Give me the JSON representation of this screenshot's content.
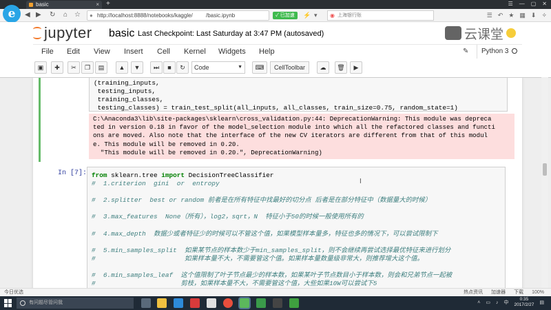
{
  "browser": {
    "tab_title": "basic",
    "tab_close": "×",
    "new_tab": "+",
    "url": "http://localhost:8888/notebooks/kaggle//basic.ipynb",
    "accelerate_label": "✓ 已加速",
    "search_placeholder": "上海银行账",
    "status_left": "今日优选",
    "status_right": [
      "热点资讯",
      "加速器",
      "下载",
      "100%"
    ]
  },
  "jupyter": {
    "logo_text": "jupyter",
    "notebook_name": "basic",
    "checkpoint": "Last Checkpoint: Last Saturday at 3:47 PM (autosaved)",
    "kernel": "Python 3",
    "menu": [
      "File",
      "Edit",
      "View",
      "Insert",
      "Cell",
      "Kernel",
      "Widgets",
      "Help"
    ],
    "cell_type": "Code",
    "celltoolbar_label": "CellToolbar"
  },
  "watermark": {
    "text": "云课堂"
  },
  "cells": {
    "cell1_code": "(training_inputs,\n testing_inputs,\n training_classes,\n testing_classes) = train_test_split(all_inputs, all_classes, train_size=0.75, random_state=1)",
    "cell1_stderr": "C:\\Anaconda3\\lib\\site-packages\\sklearn\\cross_validation.py:44: DeprecationWarning: This module was depreca\nted in version 0.18 in favor of the model_selection module into which all the refactored classes and functi\nons are moved. Also note that the interface of the new CV iterators are different from that of this modul\ne. This module will be removed in 0.20.\n  \"This module will be removed in 0.20.\", DeprecationWarning)",
    "cell2_prompt": "In [7]:",
    "cell2_import_kw1": "from",
    "cell2_import_mod": " sklearn.tree ",
    "cell2_import_kw2": "import",
    "cell2_import_name": " DecisionTreeClassifier",
    "cell2_comments": [
      "#  1.criterion  gini  or  entropy",
      "",
      "#  2.splitter  best or random 前者是在所有特征中找最好的切分点 后者是在部分特征中（数据量大的时候）",
      "",
      "#  3.max_features  None（所有），log2，sqrt，N  特征小于50的时候一般使用所有的",
      "",
      "#  4.max_depth  数据少或者特征少的时候可以不管这个值，如果模型样本量多，特征也多的情况下，可以尝试限制下",
      "",
      "#  5.min_samples_split  如果某节点的样本数少于min_samples_split，则不会继续再尝试选择最优特征来进行划分",
      "#                       如果样本量不大，不需要管这个值。如果样本量数量级非常大，则推荐增大这个值。",
      "",
      "#  6.min_samples_leaf  这个值限制了叶子节点最少的样本数，如果某叶子节点数目小于样本数，则会和兄弟节点一起被",
      "#                      剪枝，如果样本量不大，不需要管这个值，大些如果10W可以尝试下5"
    ]
  },
  "taskbar": {
    "search_placeholder": "有问题尽管问我",
    "time": "0:35",
    "date": "2017/2/27"
  },
  "colors": {
    "running_cell_border": "#66bb6a",
    "stderr_bg": "#fddede",
    "jupyter_orange": "#f37726",
    "prompt_blue": "#303f9f"
  },
  "icons": [
    "save-icon",
    "plus-icon",
    "cut-icon",
    "copy-icon",
    "paste-icon",
    "arrow-up-icon",
    "arrow-down-icon",
    "step-forward-icon",
    "stop-icon",
    "restart-icon",
    "keyboard-icon",
    "upload-icon",
    "trash-icon",
    "video-icon"
  ]
}
